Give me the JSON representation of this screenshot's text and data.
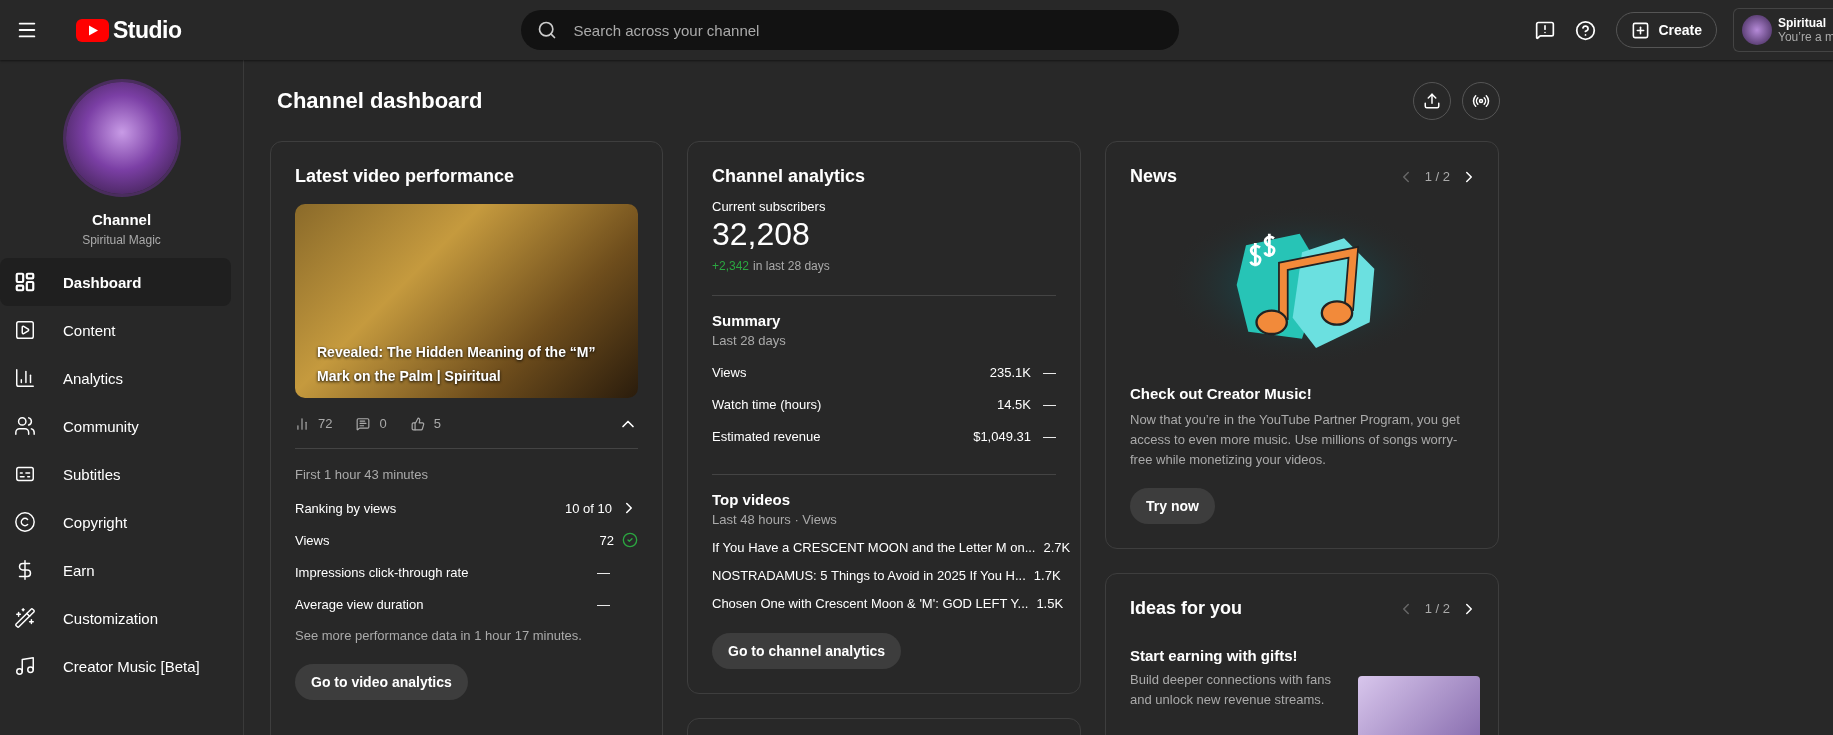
{
  "header": {
    "logo_text": "Studio",
    "search": {
      "placeholder": "Search across your channel"
    },
    "create_label": "Create",
    "account": {
      "name": "Spiritual",
      "subtitle": "You’re a m"
    }
  },
  "sidebar": {
    "channel_label": "Channel",
    "channel_name": "Spiritual Magic",
    "items": [
      {
        "label": "Dashboard",
        "selected": true
      },
      {
        "label": "Content",
        "selected": false
      },
      {
        "label": "Analytics",
        "selected": false
      },
      {
        "label": "Community",
        "selected": false
      },
      {
        "label": "Subtitles",
        "selected": false
      },
      {
        "label": "Copyright",
        "selected": false
      },
      {
        "label": "Earn",
        "selected": false
      },
      {
        "label": "Customization",
        "selected": false
      },
      {
        "label": "Creator Music [Beta]",
        "selected": false
      }
    ]
  },
  "page_title": "Channel dashboard",
  "latest_video": {
    "title": "Latest video performance",
    "video_title": "Revealed: The Hidden Meaning of the “M” Mark on the Palm | Spiritual",
    "stats": {
      "views": "72",
      "comments": "0",
      "likes": "5",
      "expanded": true
    },
    "period": "First 1 hour 43 minutes",
    "metrics": [
      {
        "kind": "link",
        "label": "Ranking by views",
        "value": "10 of 10"
      },
      {
        "kind": "check",
        "label": "Views",
        "value": "72"
      },
      {
        "kind": "plain",
        "label": "Impressions click-through rate",
        "value": "—"
      },
      {
        "kind": "plain",
        "label": "Average view duration",
        "value": "—"
      }
    ],
    "note": "See more performance data in 1 hour 17 minutes.",
    "button": "Go to video analytics"
  },
  "channel_analytics": {
    "title": "Channel analytics",
    "subscribers_label": "Current subscribers",
    "subscribers": "32,208",
    "change": "+2,342",
    "change_suffix": "in last 28 days",
    "summary_title": "Summary",
    "summary_period": "Last 28 days",
    "summary": [
      {
        "label": "Views",
        "value": "235.1K",
        "trend": "—"
      },
      {
        "label": "Watch time (hours)",
        "value": "14.5K",
        "trend": "—"
      },
      {
        "label": "Estimated revenue",
        "value": "$1,049.31",
        "trend": "—"
      }
    ],
    "top_title": "Top videos",
    "top_period": "Last 48 hours · Views",
    "top_videos": [
      {
        "title": "If You Have a CRESCENT MOON and the Letter M on...",
        "views": "2.7K"
      },
      {
        "title": "NOSTRADAMUS: 5 Things to Avoid in 2025 If You H...",
        "views": "1.7K"
      },
      {
        "title": "Chosen One with Crescent Moon & 'M': GOD LEFT Y...",
        "views": "1.5K"
      }
    ],
    "button": "Go to channel analytics"
  },
  "news": {
    "title": "News",
    "pager": {
      "text": "1 / 2",
      "prev_disabled": true
    },
    "headline": "Check out Creator Music!",
    "body": "Now that you’re in the YouTube Partner Program, you get access to even more music. Use millions of songs worry-free while monetizing your videos.",
    "button": "Try now"
  },
  "ideas": {
    "title": "Ideas for you",
    "pager": {
      "text": "1 / 2",
      "prev_disabled": true
    },
    "headline": "Start earning with gifts!",
    "body": "Build deeper connections with fans and unlock new revenue streams."
  }
}
